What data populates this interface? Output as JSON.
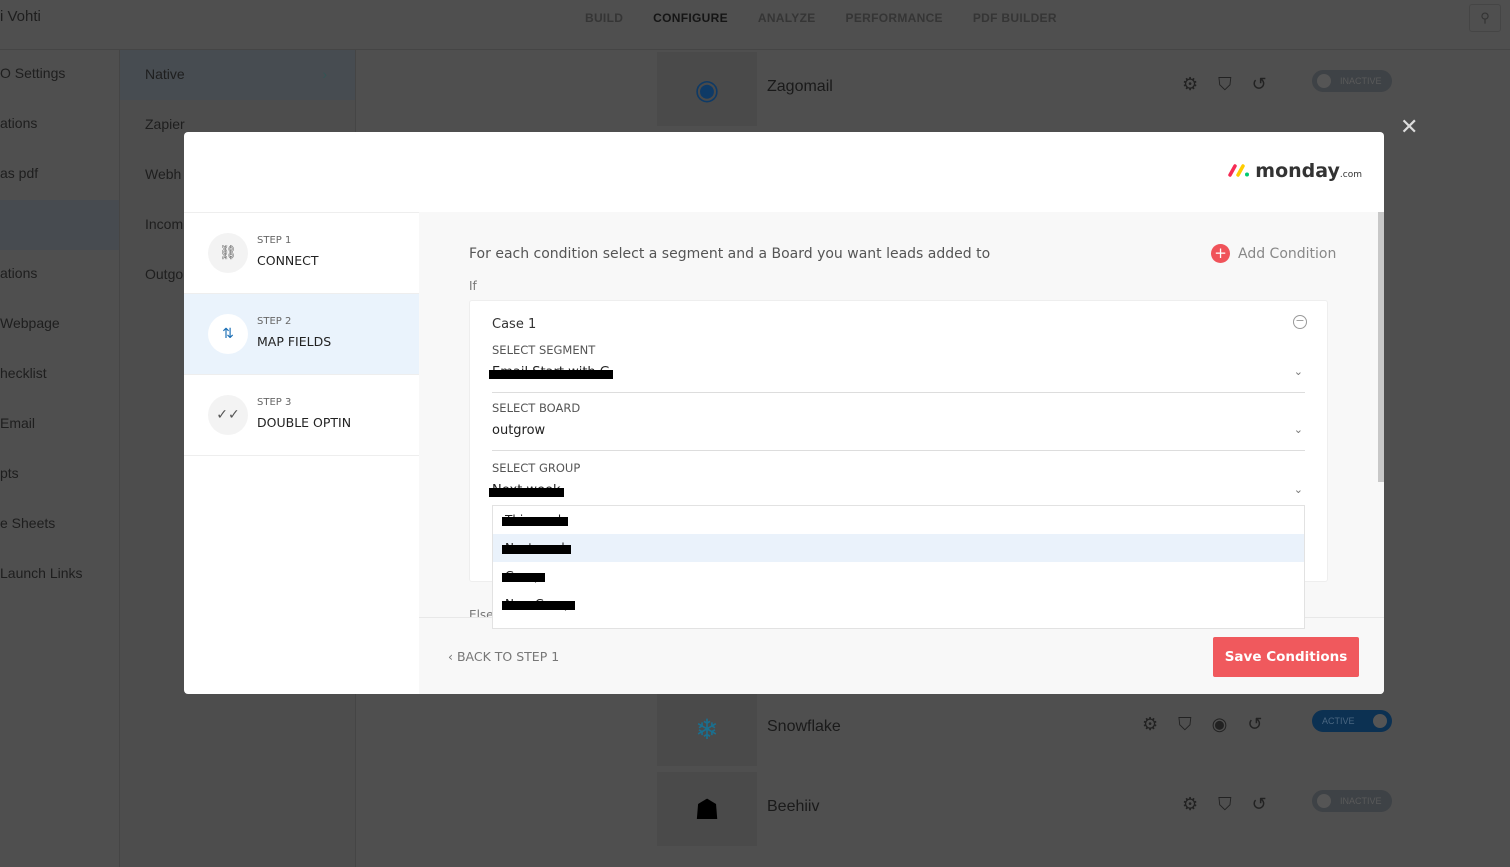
{
  "app": {
    "title": "i Vohti",
    "nav": [
      "BUILD",
      "CONFIGURE",
      "ANALYZE",
      "PERFORMANCE",
      "PDF BUILDER"
    ],
    "active_nav": "CONFIGURE"
  },
  "sidebar": {
    "items": [
      "O Settings",
      "ations",
      "as pdf",
      "",
      "ations",
      "Webpage",
      "hecklist",
      "Email",
      "pts",
      "e Sheets",
      "Launch Links"
    ]
  },
  "subnav": {
    "items": [
      "Native",
      "Zapier",
      "Webh",
      "Incom",
      "Outgo"
    ]
  },
  "integrations": [
    {
      "name": "Zagomail",
      "status": "INACTIVE",
      "icon": "zagomail-logo"
    },
    {
      "name": "Snowflake",
      "status": "ACTIVE",
      "icon": "snowflake-logo"
    },
    {
      "name": "Beehiiv",
      "status": "INACTIVE",
      "icon": "beehiiv-logo"
    }
  ],
  "modal": {
    "logo": {
      "text": "monday",
      "suffix": ".com"
    },
    "steps": [
      {
        "num": "STEP 1",
        "title": "CONNECT",
        "icon": "link-icon"
      },
      {
        "num": "STEP 2",
        "title": "MAP FIELDS",
        "icon": "map-fields-icon"
      },
      {
        "num": "STEP 3",
        "title": "DOUBLE OPTIN",
        "icon": "double-check-icon"
      }
    ],
    "instruction": "For each condition select a segment and a Board you want leads added to",
    "add_condition": "Add Condition",
    "if_label": "If",
    "else_label": "Else",
    "case": {
      "title": "Case 1",
      "segment": {
        "label": "SELECT SEGMENT",
        "value": "Email Start with G"
      },
      "board": {
        "label": "SELECT BOARD",
        "value": "outgrow"
      },
      "group": {
        "label": "SELECT GROUP",
        "value": "Next week"
      }
    },
    "group_options": [
      "This week",
      "Next week",
      "Group",
      "New Group"
    ],
    "highlighted_option": "Next week",
    "back": "BACK TO STEP 1",
    "save": "Save Conditions"
  },
  "colors": {
    "accent": "#f0595d",
    "active_toggle": "#1c6fb5"
  }
}
